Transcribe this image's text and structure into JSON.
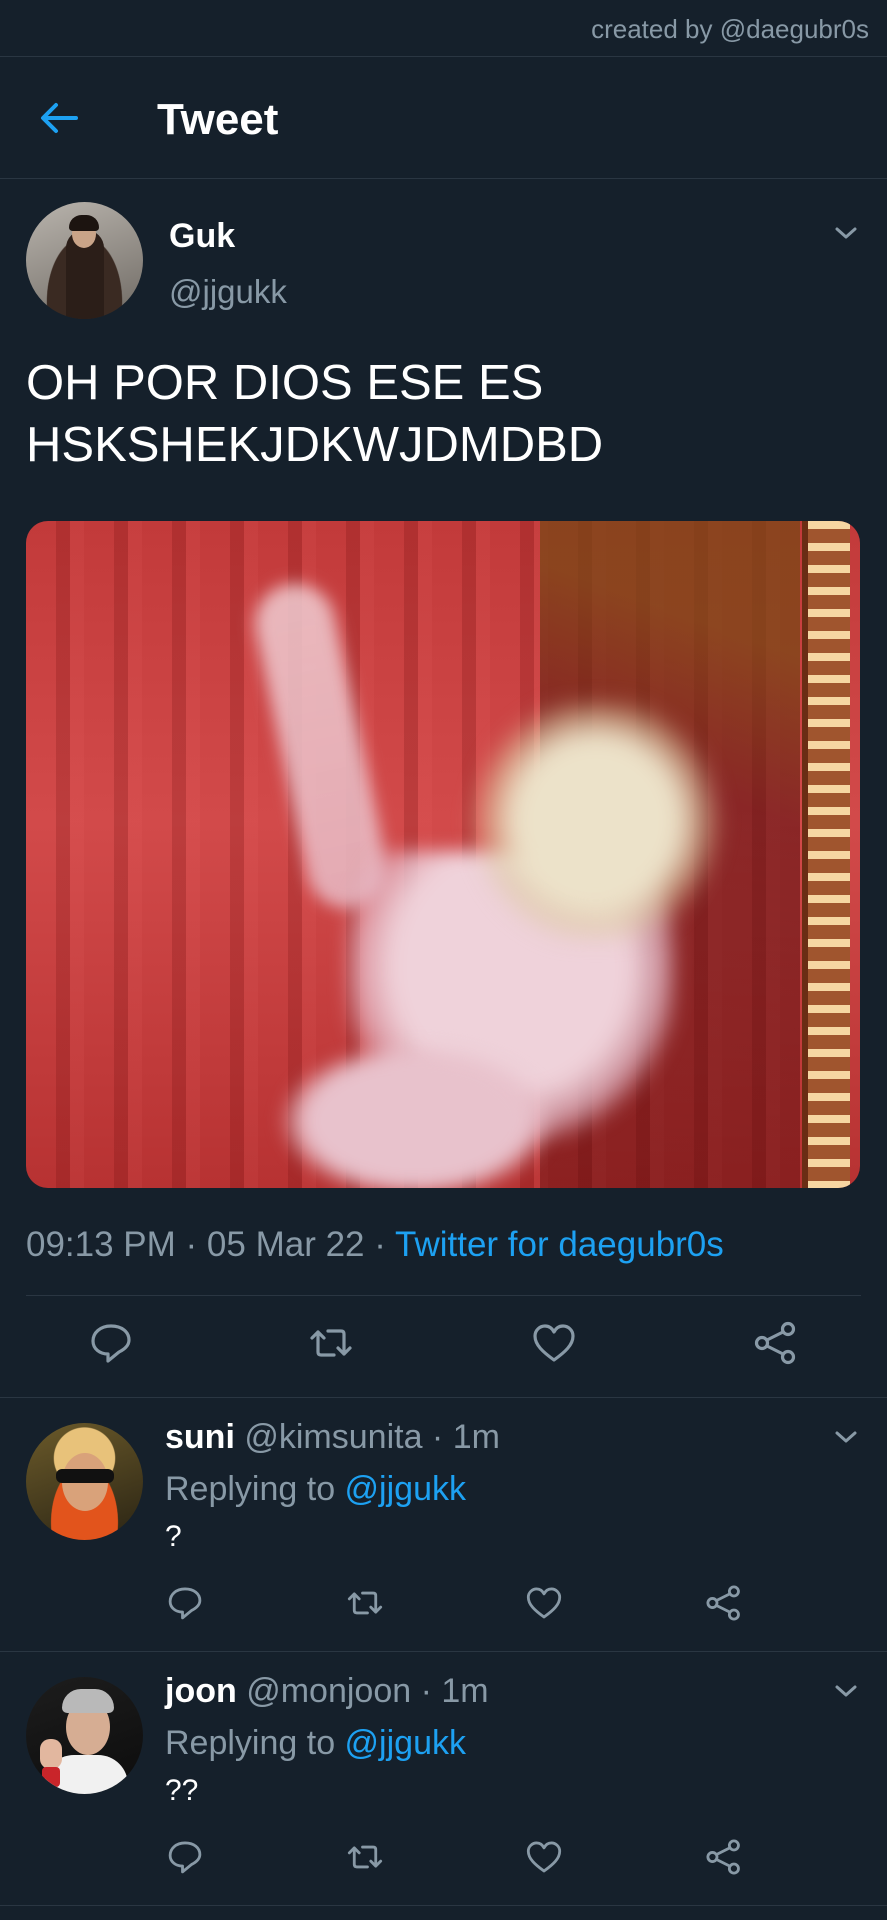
{
  "credit": "created by @daegubr0s",
  "header": {
    "title": "Tweet",
    "back_icon": "arrow-left-icon"
  },
  "colors": {
    "background": "#15202b",
    "accent": "#1da1f2",
    "muted": "#8899a6",
    "divider": "#2a3642"
  },
  "tweet": {
    "name": "Guk",
    "handle": "@jjgukk",
    "text": "OH POR DIOS ESE ES HSKSHEKJDKWJDMDBD",
    "time": "09:13 PM",
    "date_sep": " · ",
    "date": "05 Mar 22",
    "source_sep": " · ",
    "source": "Twitter for daegubr0s",
    "actions": [
      "reply-icon",
      "retweet-icon",
      "like-icon",
      "share-icon"
    ]
  },
  "replies": [
    {
      "name": "suni",
      "handle": "@kimsunita",
      "time": " · 1m",
      "replying_label": "Replying to ",
      "replying_to": "@jjgukk",
      "text": "?"
    },
    {
      "name": "joon",
      "handle": "@monjoon",
      "time": " · 1m",
      "replying_label": "Replying to ",
      "replying_to": "@jjgukk",
      "text": "??"
    }
  ]
}
